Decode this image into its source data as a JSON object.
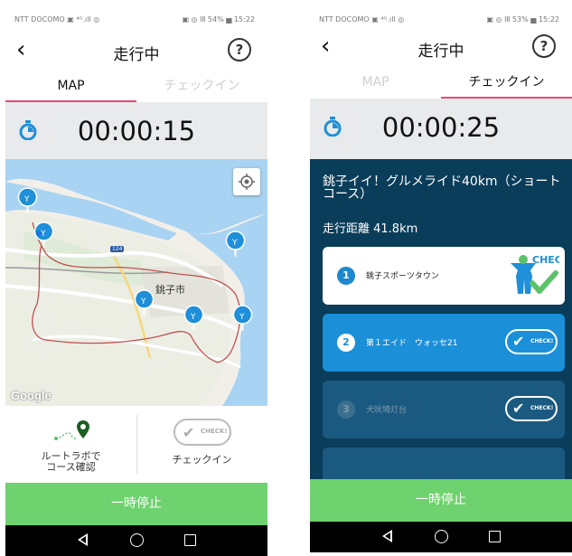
{
  "left_screen": {
    "status_left": "NTT DOCOMO ▣ ⁴ᴳ.ıll ◎",
    "status_right": "▣ ◎ ⅠⅡ 54% ▅ 15:22",
    "title": "走行中",
    "back_icon": "chevron-left-icon",
    "help_label": "?",
    "tabs": [
      {
        "label": "MAP",
        "active": true
      },
      {
        "label": "チェックイン",
        "active": false
      }
    ],
    "timer": "00:00:15",
    "map": {
      "city_label": "銚子市",
      "route_number": "124",
      "attribution": "Google"
    },
    "route_lab_label_line1": "ルートラボで",
    "route_lab_label_line2": "コース確認",
    "checkin_button_text": "CHECK!",
    "checkin_label": "チェックイン",
    "pause_label": "一時停止"
  },
  "right_screen": {
    "status_left": "NTT DOCOMO ▣ ⁴ᴳ.ıll ◎",
    "status_right": "▣ ◎ ⅠⅡ 53% ▅ 15:22",
    "title": "走行中",
    "back_icon": "chevron-left-icon",
    "help_label": "?",
    "tabs": [
      {
        "label": "MAP",
        "active": false
      },
      {
        "label": "チェックイン",
        "active": true
      }
    ],
    "timer": "00:00:25",
    "course_title": "銚子イイ！グルメライド40km（ショートコース）",
    "distance": "走行距離 41.8km",
    "checkpoints": [
      {
        "number": "1",
        "name": "銚子スポーツタウン",
        "state": "checked",
        "badge": "CHECK!"
      },
      {
        "number": "2",
        "name": "第１エイド　ウォッセ21",
        "state": "current",
        "badge": "CHECK!"
      },
      {
        "number": "3",
        "name": "犬吠埼灯台",
        "state": "upcoming",
        "badge": "CHECK!"
      }
    ],
    "pause_label": "一時停止"
  },
  "colors": {
    "accent_pink": "#e8497a",
    "pause_green": "#6ed26e",
    "panel_navy": "#0a3d5a",
    "active_blue": "#1b8fd8",
    "pin_blue": "#1e8fd8",
    "check_green": "#5cc26a"
  }
}
